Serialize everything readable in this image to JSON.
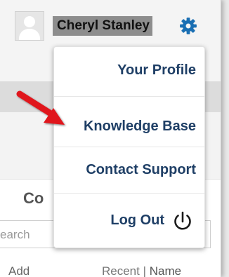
{
  "header": {
    "user_name": "Cheryl Stanley"
  },
  "account_menu": {
    "items": [
      {
        "label": "Your Profile"
      },
      {
        "label": "Knowledge Base"
      },
      {
        "label": "Contact Support"
      },
      {
        "label": "Log Out"
      }
    ]
  },
  "panel": {
    "title": "Co",
    "search_placeholder": "earch",
    "add_label": "Add",
    "sort_recent": "Recent",
    "sort_separator": "|",
    "sort_name": "Name"
  },
  "colors": {
    "accent": "#1a6fb3",
    "menu_text": "#1f3f66",
    "arrow": "#e0161e",
    "name_highlight": "#8d8d8d"
  },
  "icons": {
    "avatar": "user-avatar-icon",
    "settings": "gear-icon",
    "logout": "power-icon",
    "annotation": "red-arrow-icon"
  }
}
